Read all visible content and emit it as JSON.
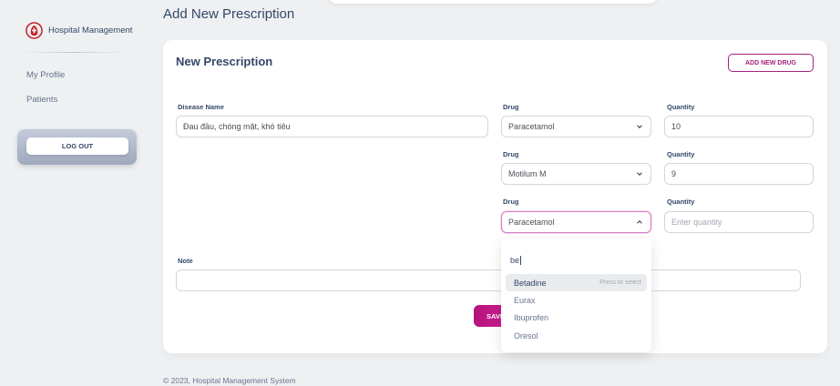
{
  "sidebar": {
    "brand": "Hospital Management",
    "nav": [
      {
        "label": "My Profile"
      },
      {
        "label": "Patients"
      }
    ],
    "logout_label": "LOG OUT"
  },
  "page": {
    "title": "Add New Prescription"
  },
  "form": {
    "title": "New Prescription",
    "add_drug_label": "ADD NEW DRUG",
    "disease_label": "Disease Name",
    "disease_value": "Đau đầu, chóng mặt, khó tiêu",
    "drug_label": "Drug",
    "quantity_label": "Quantity",
    "rows": [
      {
        "drug": "Paracetamol",
        "quantity": "10"
      },
      {
        "drug": "Motilum M",
        "quantity": "9"
      },
      {
        "drug": "Paracetamol",
        "quantity": "",
        "quantity_placeholder": "Enter quantity"
      }
    ],
    "note_label": "Note",
    "note_value": "",
    "save_label": "SAVE"
  },
  "dropdown": {
    "search_value": "be",
    "options": [
      {
        "label": "Betadine",
        "hint": "Press to select"
      },
      {
        "label": "Eurax"
      },
      {
        "label": "Ibuprofen"
      },
      {
        "label": "Oresol"
      }
    ]
  },
  "footer": {
    "text": "© 2023, Hospital Management System"
  },
  "colors": {
    "accent": "#a3247f",
    "save_gradient_start": "#b3137d",
    "save_gradient_end": "#e0249a",
    "brand_logo": "#c0262d"
  },
  "icons": {
    "brand": "hospital-logo-icon",
    "select_closed": "chevron-down-icon",
    "select_open": "chevron-up-icon"
  }
}
